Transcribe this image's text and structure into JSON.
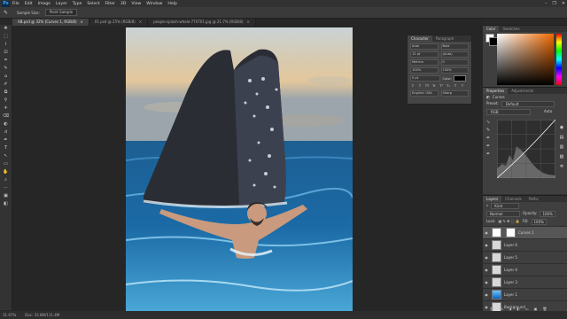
{
  "menubar": {
    "logo": "Ps",
    "items": [
      "File",
      "Edit",
      "Image",
      "Layer",
      "Type",
      "Select",
      "Filter",
      "3D",
      "View",
      "Window",
      "Help"
    ],
    "window_controls": [
      "–",
      "❐",
      "✕"
    ]
  },
  "options": {
    "sample_size_label": "Sample Size:",
    "sample_value": "Point Sample"
  },
  "tabs": [
    {
      "label": "AB.psd @ 32% (Curves 1, RGB/8)",
      "close": "×"
    },
    {
      "label": "01.psd @ 25% (RGB/8)",
      "close": "×"
    },
    {
      "label": "people-splash-whale-770701.jpg @ 21.7% (RGB/8)",
      "close": "×"
    }
  ],
  "tools": [
    "✥",
    "⬚",
    "⌇",
    "⊡",
    "⌗",
    "✎",
    "⌂",
    "✐",
    "⧉",
    "⚲",
    "✈",
    "⌫",
    "◐",
    "☌",
    "✒",
    "T",
    "↖",
    "▭",
    "✋",
    "⌕",
    "⋯",
    "▣",
    "◧"
  ],
  "status": {
    "zoom": "31.67%",
    "doc": "Doc: 33.8M/111.4M"
  },
  "character": {
    "tabs": [
      "Character",
      "Paragraph"
    ],
    "font": "Arial",
    "style": "Bold",
    "size": "12 pt",
    "leading": "(Auto)",
    "kerning": "Metrics",
    "tracking": "0",
    "vscale": "100%",
    "hscale": "100%",
    "baseline": "0 pt",
    "color_label": "Color:",
    "type_buttons": [
      "T",
      "T",
      "TT",
      "Tr",
      "T¹",
      "T₁",
      "T",
      "T"
    ],
    "language": "English: USA",
    "aa": "Sharp"
  },
  "color_panel": {
    "tabs": [
      "Color",
      "Swatches"
    ]
  },
  "properties": {
    "tabs": [
      "Properties",
      "Adjustments"
    ],
    "title": "Curves",
    "preset_label": "Preset:",
    "preset_value": "Default",
    "channel": "RGB",
    "auto": "Auto"
  },
  "layers": {
    "tabs": [
      "Layers",
      "Channels",
      "Paths"
    ],
    "kind": "Kind",
    "blend": "Normal",
    "opacity_label": "Opacity:",
    "opacity": "100%",
    "lock_label": "Lock:",
    "fill_label": "Fill:",
    "fill": "100%",
    "items": [
      {
        "name": "Curves 1",
        "selected": true
      },
      {
        "name": "Layer 6",
        "selected": false
      },
      {
        "name": "Layer 5",
        "selected": false
      },
      {
        "name": "Layer 4",
        "selected": false
      },
      {
        "name": "Layer 3",
        "selected": false
      },
      {
        "name": "Layer 1",
        "selected": false
      },
      {
        "name": "Background",
        "selected": false
      }
    ],
    "footer_icons": [
      "⛓",
      "fx",
      "◑",
      "◐",
      "▭",
      "▣",
      "🗑"
    ]
  }
}
